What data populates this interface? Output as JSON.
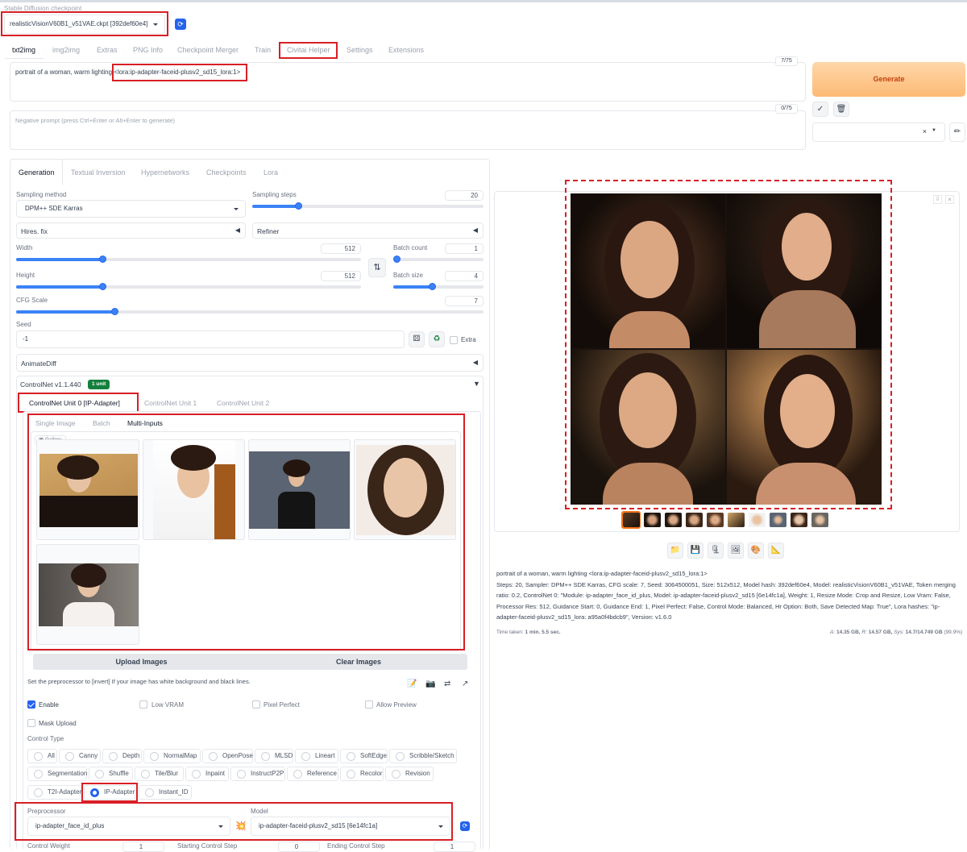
{
  "header": {
    "checkpoint_label": "Stable Diffusion checkpoint",
    "checkpoint_value": "realisticVisionV60B1_v51VAE.ckpt [392def60e4]",
    "refresh_icon": "refresh-icon"
  },
  "main_tabs": [
    "txt2img",
    "img2img",
    "Extras",
    "PNG Info",
    "Checkpoint Merger",
    "Train",
    "Civitai Helper",
    "Settings",
    "Extensions"
  ],
  "prompt": {
    "text": "portrait of a woman, warm lighting ",
    "lora": "<lora:ip-adapter-faceid-plusv2_sd15_lora:1>",
    "token_count": "7/75"
  },
  "negative_prompt": {
    "placeholder": "Negative prompt (press Ctrl+Enter or Alt+Enter to generate)",
    "token_count": "0/75"
  },
  "generate_label": "Generate",
  "sub_tabs": [
    "Generation",
    "Textual Inversion",
    "Hypernetworks",
    "Checkpoints",
    "Lora"
  ],
  "generation": {
    "sampling_method_label": "Sampling method",
    "sampling_method_value": "DPM++ SDE Karras",
    "sampling_steps_label": "Sampling steps",
    "sampling_steps_value": "20",
    "sampling_steps_level": 0.2,
    "hires_fix_label": "Hires. fix",
    "refiner_label": "Refiner",
    "width_label": "Width",
    "width_value": "512",
    "width_level": 0.25,
    "height_label": "Height",
    "height_value": "512",
    "height_level": 0.25,
    "batch_count_label": "Batch count",
    "batch_count_value": "1",
    "batch_count_level": 0.0,
    "batch_size_label": "Batch size",
    "batch_size_value": "4",
    "batch_size_level": 0.43,
    "cfg_label": "CFG Scale",
    "cfg_value": "7",
    "cfg_level": 0.21,
    "seed_label": "Seed",
    "seed_value": "-1",
    "extra_label": "Extra",
    "animatediff_label": "AnimateDiff"
  },
  "controlnet": {
    "title": "ControlNet v1.1.440",
    "units_badge": "1 unit",
    "unit_tabs": [
      "ControlNet Unit 0 [IP-Adapter]",
      "ControlNet Unit 1",
      "ControlNet Unit 2"
    ],
    "input_tabs": [
      "Single Image",
      "Batch",
      "Multi-Inputs"
    ],
    "gallery_label": "Gallery",
    "upload_label": "Upload Images",
    "clear_label": "Clear Images",
    "hint": "Set the preprocessor to [invert] If your image has white background and black lines.",
    "enable_label": "Enable",
    "low_vram_label": "Low VRAM",
    "pixel_perfect_label": "Pixel Perfect",
    "allow_preview_label": "Allow Preview",
    "mask_upload_label": "Mask Upload",
    "control_type_label": "Control Type",
    "control_types": [
      "All",
      "Canny",
      "Depth",
      "NormalMap",
      "OpenPose",
      "MLSD",
      "Lineart",
      "SoftEdge",
      "Scribble/Sketch",
      "Segmentation",
      "Shuffle",
      "Tile/Blur",
      "Inpaint",
      "InstructP2P",
      "Reference",
      "Recolor",
      "Revision",
      "T2I-Adapter",
      "IP-Adapter",
      "Instant_ID"
    ],
    "selected_type": "IP-Adapter",
    "preprocessor_label": "Preprocessor",
    "preprocessor_value": "ip-adapter_face_id_plus",
    "model_label": "Model",
    "model_value": "ip-adapter-faceid-plusv2_sd15 [6e14fc1a]",
    "control_weight_label": "Control Weight",
    "control_weight_value": "1",
    "starting_step_label": "Starting Control Step",
    "starting_step_value": "0",
    "ending_step_label": "Ending Control Step",
    "ending_step_value": "1"
  },
  "output": {
    "info_prompt": "portrait of a woman, warm lighting <lora:ip-adapter-faceid-plusv2_sd15_lora:1>",
    "info_params": "Steps: 20, Sampler: DPM++ SDE Karras, CFG scale: 7, Seed: 3064500051, Size: 512x512, Model hash: 392def60e4, Model: realisticVisionV60B1_v51VAE, Token merging ratio: 0.2, ControlNet 0: \"Module: ip-adapter_face_id_plus, Model: ip-adapter-faceid-plusv2_sd15 [6e14fc1a], Weight: 1, Resize Mode: Crop and Resize, Low Vram: False, Processor Res: 512, Guidance Start: 0, Guidance End: 1, Pixel Perfect: False, Control Mode: Balanced, Hr Option: Both, Save Detected Map: True\", Lora hashes: \"ip-adapter-faceid-plusv2_sd15_lora: a95a0f4bdcb9\", Version: v1.6.0",
    "time_taken_label": "Time taken:",
    "time_taken_value": "1 min. 5.5 sec.",
    "vram_a_label": "A:",
    "vram_a": "14.35 GB,",
    "vram_r_label": "R:",
    "vram_r": "14.57 GB,",
    "vram_sys_label": "Sys:",
    "vram_sys": "14.7/14.749 GB",
    "vram_pct": "(99.9%)"
  },
  "colors": {
    "accent": "#2563eb",
    "highlight_red": "#d81f26",
    "generate_bg": "#fdba74",
    "generate_text": "#c2410c",
    "badge_green": "#15803d"
  }
}
